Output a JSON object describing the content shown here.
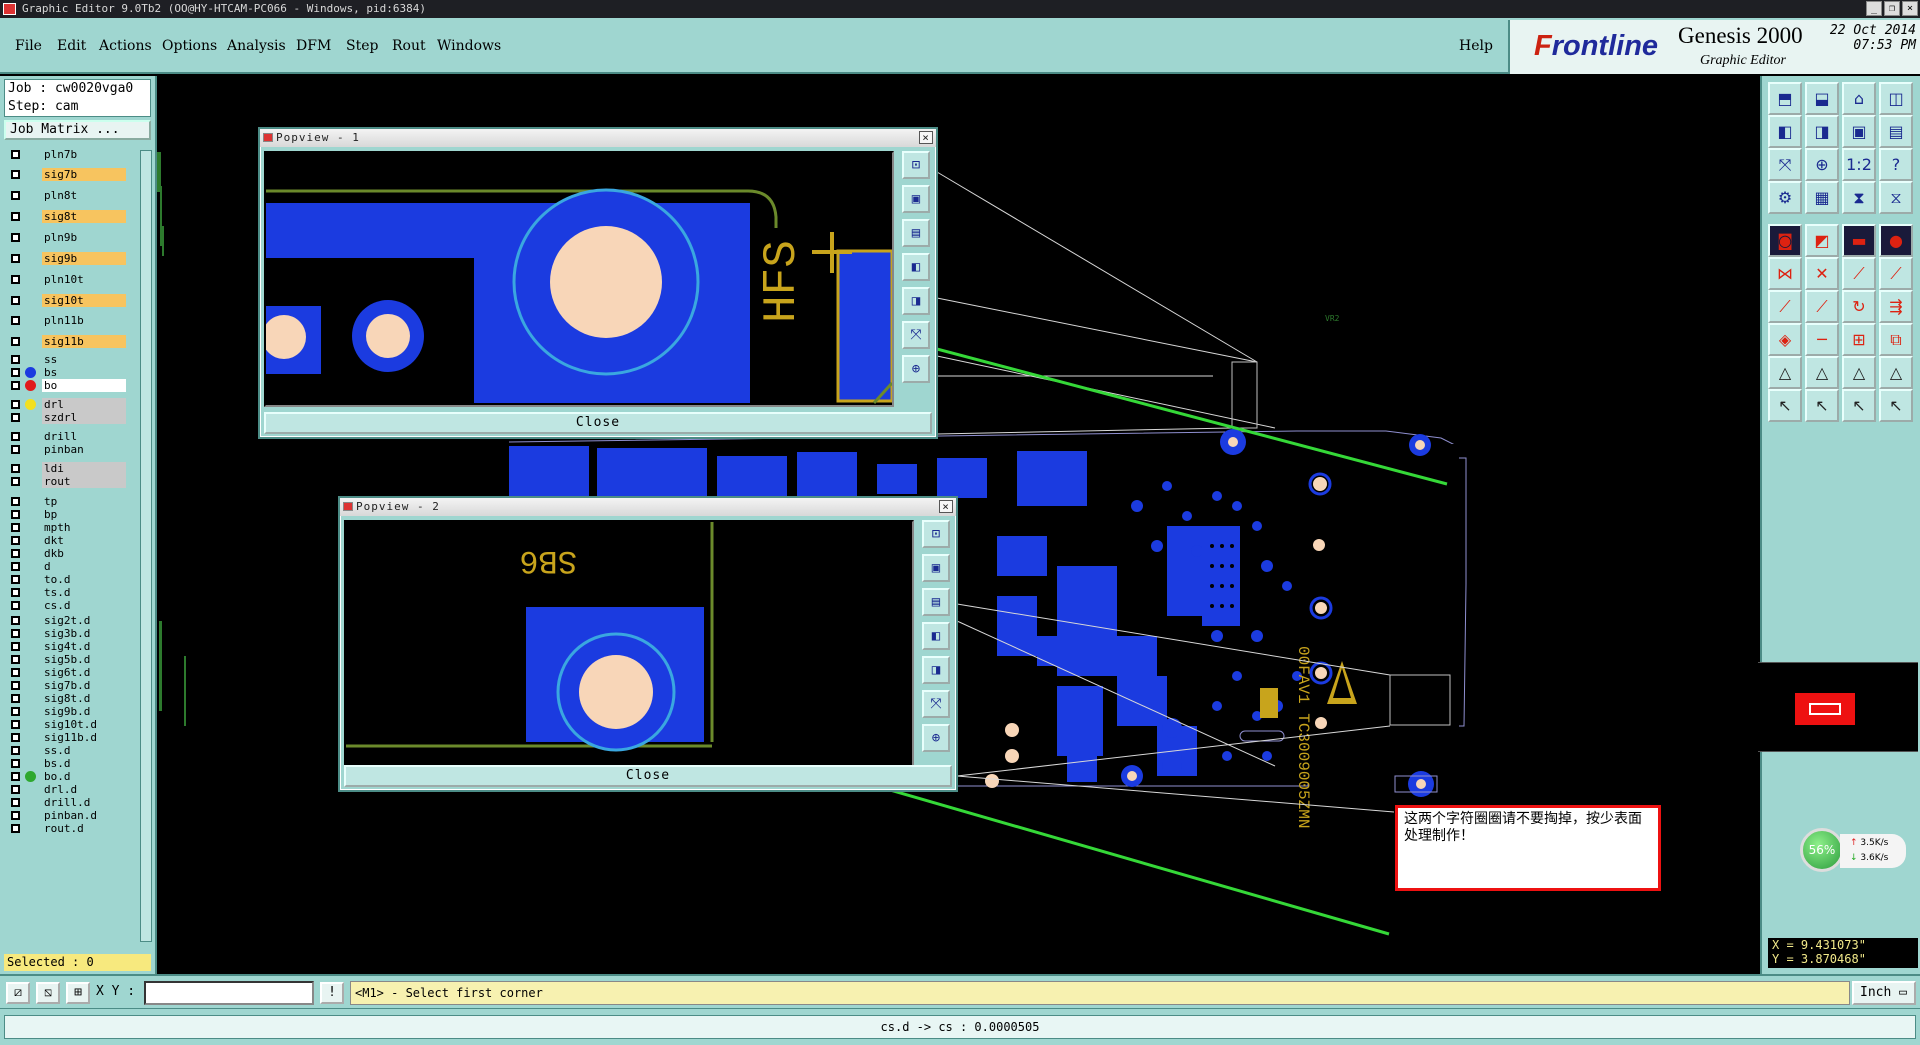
{
  "window": {
    "title": "Graphic Editor 9.0Tb2 (OO@HY-HTCAM-PC066 - Windows, pid:6384)"
  },
  "menu": {
    "items": [
      "File",
      "Edit",
      "Actions",
      "Options",
      "Analysis",
      "DFM",
      "Step",
      "Rout",
      "Windows"
    ],
    "help": "Help"
  },
  "brand": {
    "logo_prefix": "F",
    "logo_rest": "rontline",
    "product": "Genesis 2000",
    "subtitle": "Graphic Editor",
    "date": "22 Oct 2014",
    "time": "07:53 PM"
  },
  "job": {
    "job_line": "Job : cw0020vga0",
    "step_line": "Step: cam",
    "matrix_button": "Job Matrix ..."
  },
  "layers": [
    {
      "name": "pln7b",
      "style": "board",
      "dot": ""
    },
    {
      "name": "sig7b",
      "style": "sig",
      "dot": ""
    },
    {
      "name": "pln8t",
      "style": "board",
      "dot": ""
    },
    {
      "name": "sig8t",
      "style": "sig",
      "dot": ""
    },
    {
      "name": "pln9b",
      "style": "board",
      "dot": ""
    },
    {
      "name": "sig9b",
      "style": "sig",
      "dot": ""
    },
    {
      "name": "pln10t",
      "style": "board",
      "dot": ""
    },
    {
      "name": "sig10t",
      "style": "sig",
      "dot": ""
    },
    {
      "name": "pln11b",
      "style": "board",
      "dot": ""
    },
    {
      "name": "sig11b",
      "style": "sig",
      "dot": ""
    },
    {
      "name": "ss",
      "style": "board",
      "dot": ""
    },
    {
      "name": "bs",
      "style": "board",
      "dot": "#1b3be0"
    },
    {
      "name": "bo",
      "style": "white",
      "dot": "#e01b1b",
      "mark": "⬋"
    },
    {
      "name": "drl",
      "style": "grey",
      "dot": "#f2e020"
    },
    {
      "name": "szdrl",
      "style": "grey",
      "dot": ""
    },
    {
      "name": "drill",
      "style": "board",
      "dot": "",
      "mark": "⬋"
    },
    {
      "name": "pinban",
      "style": "board",
      "dot": ""
    },
    {
      "name": "ldi",
      "style": "grey",
      "dot": ""
    },
    {
      "name": "rout",
      "style": "grey",
      "dot": ""
    },
    {
      "name": "tp",
      "style": "board",
      "dot": ""
    },
    {
      "name": "bp",
      "style": "board",
      "dot": ""
    },
    {
      "name": "mpth",
      "style": "board",
      "dot": ""
    },
    {
      "name": "dkt",
      "style": "board",
      "dot": ""
    },
    {
      "name": "dkb",
      "style": "board",
      "dot": ""
    },
    {
      "name": "d",
      "style": "board",
      "dot": ""
    },
    {
      "name": "to.d",
      "style": "board",
      "dot": "",
      "mark": "⬋"
    },
    {
      "name": "ts.d",
      "style": "board",
      "dot": ""
    },
    {
      "name": "cs.d",
      "style": "board",
      "dot": ""
    },
    {
      "name": "sig2t.d",
      "style": "board",
      "dot": ""
    },
    {
      "name": "sig3b.d",
      "style": "board",
      "dot": ""
    },
    {
      "name": "sig4t.d",
      "style": "board",
      "dot": ""
    },
    {
      "name": "sig5b.d",
      "style": "board",
      "dot": ""
    },
    {
      "name": "sig6t.d",
      "style": "board",
      "dot": ""
    },
    {
      "name": "sig7b.d",
      "style": "board",
      "dot": ""
    },
    {
      "name": "sig8t.d",
      "style": "board",
      "dot": ""
    },
    {
      "name": "sig9b.d",
      "style": "board",
      "dot": ""
    },
    {
      "name": "sig10t.d",
      "style": "board",
      "dot": ""
    },
    {
      "name": "sig11b.d",
      "style": "board",
      "dot": ""
    },
    {
      "name": "ss.d",
      "style": "board",
      "dot": ""
    },
    {
      "name": "bs.d",
      "style": "board",
      "dot": ""
    },
    {
      "name": "bo.d",
      "style": "board",
      "dot": "#2ea82e",
      "mark": "⬋"
    },
    {
      "name": "drl.d",
      "style": "board",
      "dot": ""
    },
    {
      "name": "drill.d",
      "style": "board",
      "dot": "",
      "mark": "⬋"
    },
    {
      "name": "pinban.d",
      "style": "board",
      "dot": ""
    },
    {
      "name": "rout.d",
      "style": "board",
      "dot": ""
    }
  ],
  "selected": "Selected : 0",
  "popview1": {
    "title": "Popview - 1",
    "close": "Close",
    "silk_text": "HFS"
  },
  "popview2": {
    "title": "Popview - 2",
    "close": "Close",
    "silk_text": "SB6"
  },
  "note": {
    "text": "这两个字符圈圈请不要掏掉，按少表面处理制作！"
  },
  "coords": {
    "x": "X = 9.431073\"",
    "y": "Y = 3.870468\""
  },
  "gauge": {
    "percent": "56%",
    "up": "3.5K/s",
    "down": "3.6K/s"
  },
  "bottom": {
    "xy_label": "X Y :",
    "prompt": "<M1> - Select first corner",
    "unit": "Inch",
    "status": "cs.d -> cs : 0.0000505"
  },
  "toolbar_icons": [
    "open-icon",
    "save-icon",
    "home-icon",
    "zoom-window-icon",
    "pan-left-icon",
    "pan-right-icon",
    "zoom-in-icon",
    "zoom-out-icon",
    "fit-icon",
    "center-icon",
    "ratio-icon",
    "help-icon",
    "snap-icon",
    "grid-icon",
    "measure-icon",
    "align-icon",
    "pad-icon",
    "shape-icon",
    "film-icon",
    "dot-icon",
    "net-icon",
    "cross-icon",
    "line-icon",
    "graph-icon",
    "slope-icon",
    "diag-icon",
    "arc-icon",
    "split-icon",
    "marker-icon",
    "hline-icon",
    "box-icon",
    "copy-icon",
    "tri1-icon",
    "tri2-icon",
    "tri3-icon",
    "tri4-icon",
    "cursor1-icon",
    "cursor2-icon",
    "cursor3-icon",
    "cursor4-icon"
  ],
  "colors": {
    "copper": "#1b3be0",
    "pad": "#f8d6b8",
    "silk": "#c8a41c",
    "arrow": "#35d838",
    "ui": "#9fd6d0"
  }
}
